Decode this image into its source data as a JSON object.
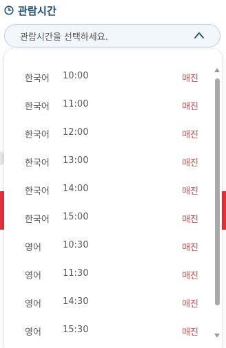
{
  "header": {
    "title": "관람시간",
    "icon": "clock-icon"
  },
  "select": {
    "placeholder": "관람시간을 선택하세요.",
    "icon": "chevron-up-icon"
  },
  "options": [
    {
      "lang": "한국어",
      "time": "10:00",
      "status": "매진"
    },
    {
      "lang": "한국어",
      "time": "11:00",
      "status": "매진"
    },
    {
      "lang": "한국어",
      "time": "12:00",
      "status": "매진"
    },
    {
      "lang": "한국어",
      "time": "13:00",
      "status": "매진"
    },
    {
      "lang": "한국어",
      "time": "14:00",
      "status": "매진"
    },
    {
      "lang": "한국어",
      "time": "15:00",
      "status": "매진"
    },
    {
      "lang": "영어",
      "time": "10:30",
      "status": "매진"
    },
    {
      "lang": "영어",
      "time": "11:30",
      "status": "매진"
    },
    {
      "lang": "영어",
      "time": "14:30",
      "status": "매진"
    },
    {
      "lang": "영어",
      "time": "15:30",
      "status": "매진"
    }
  ],
  "colors": {
    "accent": "#1f4d73",
    "sold_out": "#e0454a",
    "select_bg": "#f1f6fa",
    "brand_red": "#e0333c"
  }
}
